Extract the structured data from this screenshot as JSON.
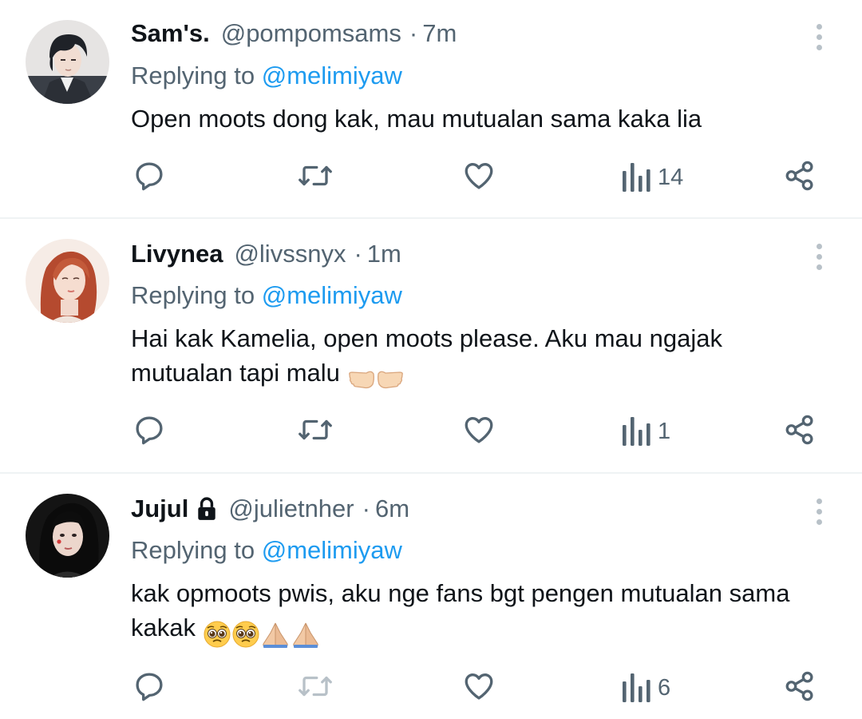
{
  "colors": {
    "text_primary": "#0f1419",
    "text_secondary": "#536471",
    "accent": "#1d9bf0",
    "divider": "#eff3f4",
    "icon": "#536471"
  },
  "tweets": [
    {
      "name": "Sam's.",
      "handle": "@pompomsams",
      "dot": "·",
      "time": "7m",
      "reply_prefix": "Replying to ",
      "reply_to": "@melimiyaw",
      "text": "Open moots dong kak, mau mutualan sama kaka lia",
      "emoji": [],
      "views": "14",
      "locked": false,
      "avatar": "avatar-dark-haired-man"
    },
    {
      "name": "Livynea",
      "handle": "@livssnyx",
      "dot": "·",
      "time": "1m",
      "reply_prefix": "Replying to ",
      "reply_to": "@melimiyaw",
      "text": "Hai kak Kamelia, open moots please. Aku mau ngajak mutualan tapi malu",
      "emoji": [
        "pointing-fingers-emoji"
      ],
      "views": "1",
      "locked": false,
      "avatar": "avatar-red-haired-woman"
    },
    {
      "name": "Jujul",
      "handle": "@julietnher",
      "dot": "·",
      "time": "6m",
      "reply_prefix": "Replying to ",
      "reply_to": "@melimiyaw",
      "text": "kak opmoots pwis, aku nge fans bgt pengen mutualan sama kakak",
      "emoji": [
        "pleading-face-emoji",
        "pleading-face-emoji",
        "folded-hands-emoji",
        "folded-hands-emoji"
      ],
      "views": "6",
      "locked": true,
      "avatar": "avatar-dark-haired-woman"
    }
  ]
}
